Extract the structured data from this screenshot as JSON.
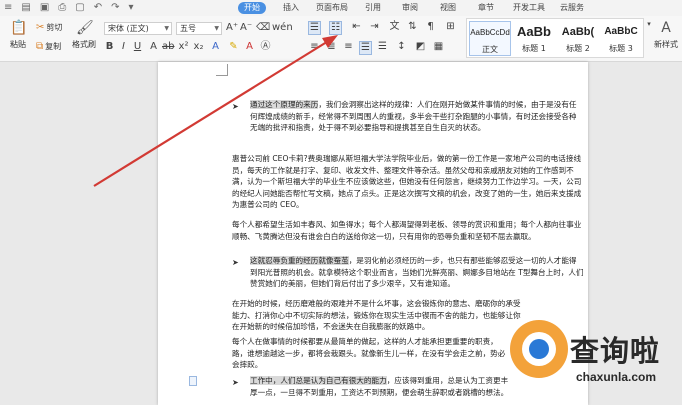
{
  "menubar": {
    "tabs": [
      "开始",
      "插入",
      "页面布局",
      "引用",
      "审阅",
      "视图",
      "章节",
      "开发工具",
      "云服务"
    ],
    "active_tab": "开始"
  },
  "ribbon": {
    "paste": "粘贴",
    "cut": "剪切",
    "copy": "复制",
    "format_painter": "格式刷",
    "font_name": "宋体 (正文)",
    "font_size": "五号",
    "styles": [
      {
        "preview": "AaBbCcDd",
        "name": "正文"
      },
      {
        "preview": "AaBb",
        "name": "标题 1"
      },
      {
        "preview": "AaBb(",
        "name": "标题 2"
      },
      {
        "preview": "AaBbC",
        "name": "标题 3"
      }
    ],
    "new_style": "新样式"
  },
  "document": {
    "para1": "通过这个原理的来历，我们会洞察出这样的规律：人们在刚开始做某件事情的时候，由于是没有任何辉煌成绩的新手，经常得不到周围人的重视，多半会干些打杂跑腿的小事情，有时还会接受各种无端的批评和指责，处于得不到必要指导和提携甚至自生自灭的状态。",
    "para1_highlight": "通过这个原理的来历",
    "para2": "惠普公司前 CEO卡莉?费奥瑞娜从斯坦福大学法学院毕业后，做的第一份工作是一家地产公司的电话接线员，每天的工作就是打字、复印、收发文件、整理文件等杂活。虽然父母和亲戚朋友对她的工作感到不满，认为一个斯坦福大学的毕业生不应该做这些，但她没有任何怨言，继续努力工作边学习。一天，公司的经纪人问她能否帮忙写文稿，她点了点头。正是这次撰写文稿的机会，改变了她的一生，她后来支援成为惠普公司的 CEO。",
    "para3": "每个人都希望生活如丰春风、如鱼得水；每个人都渴望得到老板、领导的赏识和重用；每个人都向往事业顺畅、飞黄腾达但没有谁会白白的送给你这一切，只有用你的恐辱负重和坚韧不屈去赢取。",
    "para4": "这就忍辱负重的经历就像蚕茧，是羽化前必须经历的一步，也只有那些能够忍受这一切的人才能得到阳光普照的机会。就拿模特这个职业而言，当她们光鲜亮丽、婀娜多目地站在 T型舞台上时，人们赞赏她们的美丽，但她们背后付出了多少艰辛，又有谁知道。在开始的时候，经历磨难般的艰难并不是什么坏事，这会锻炼你的意志、磨砺你的承受能力、打消你心中不切实际的想法，锻炼你在现实生活中锲而不舍的能力，也能够让你在开始新的时候倍加珍惜，不会迷失在自我膨胀的妖路中。",
    "para4_highlight": "这就忍辱负重的经历就像蚕茧",
    "para5": "每个人在做事情的时候都要从最简单的做起，这样的人才能承担更重要的职责，路，谁想逾越这一步，都将会栽跟头。就像新生儿一样，在没有学会走之前，势必会摔跤。",
    "para6": "工作中，人们总是认为自己有很大的能力，应该得到重用，总是认为工资更丰厚一点，一旦得不到重用，工资达不到预期，便会萌生辞职或者跳槽的想法。",
    "para6_highlight": "工作中，人们总是认为自己有很大的能力"
  },
  "watermark": {
    "title": "查询啦",
    "url": "chaxunla.com"
  },
  "colors": {
    "accent": "#4a90e2",
    "arrow": "#d23a34",
    "logo_orange": "#f3a23a",
    "logo_blue": "#2a79d6"
  }
}
